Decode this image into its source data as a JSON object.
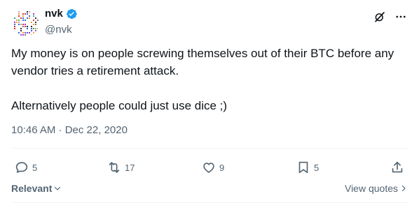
{
  "author": {
    "display_name": "nvk",
    "handle": "@nvk",
    "verified": true,
    "avatar_icon": "pixel-pattern-avatar"
  },
  "header_actions": {
    "grok_icon": "grok-slash-icon",
    "more_icon": "more-horizontal-icon"
  },
  "tweet": {
    "paragraphs": [
      "My money is on people screwing themselves out of their BTC before any vendor tries a retirement attack.",
      "Alternatively people could just use dice ;)"
    ],
    "timestamp": "10:46 AM · Dec 22, 2020"
  },
  "actions": {
    "reply_count": "5",
    "repost_count": "17",
    "like_count": "9",
    "bookmark_count": "5"
  },
  "footer": {
    "sort_label": "Relevant",
    "view_quotes_label": "View quotes"
  },
  "colors": {
    "text": "#0f1419",
    "muted": "#536471",
    "verified": "#1d9bf0",
    "divider": "#eff3f4"
  }
}
